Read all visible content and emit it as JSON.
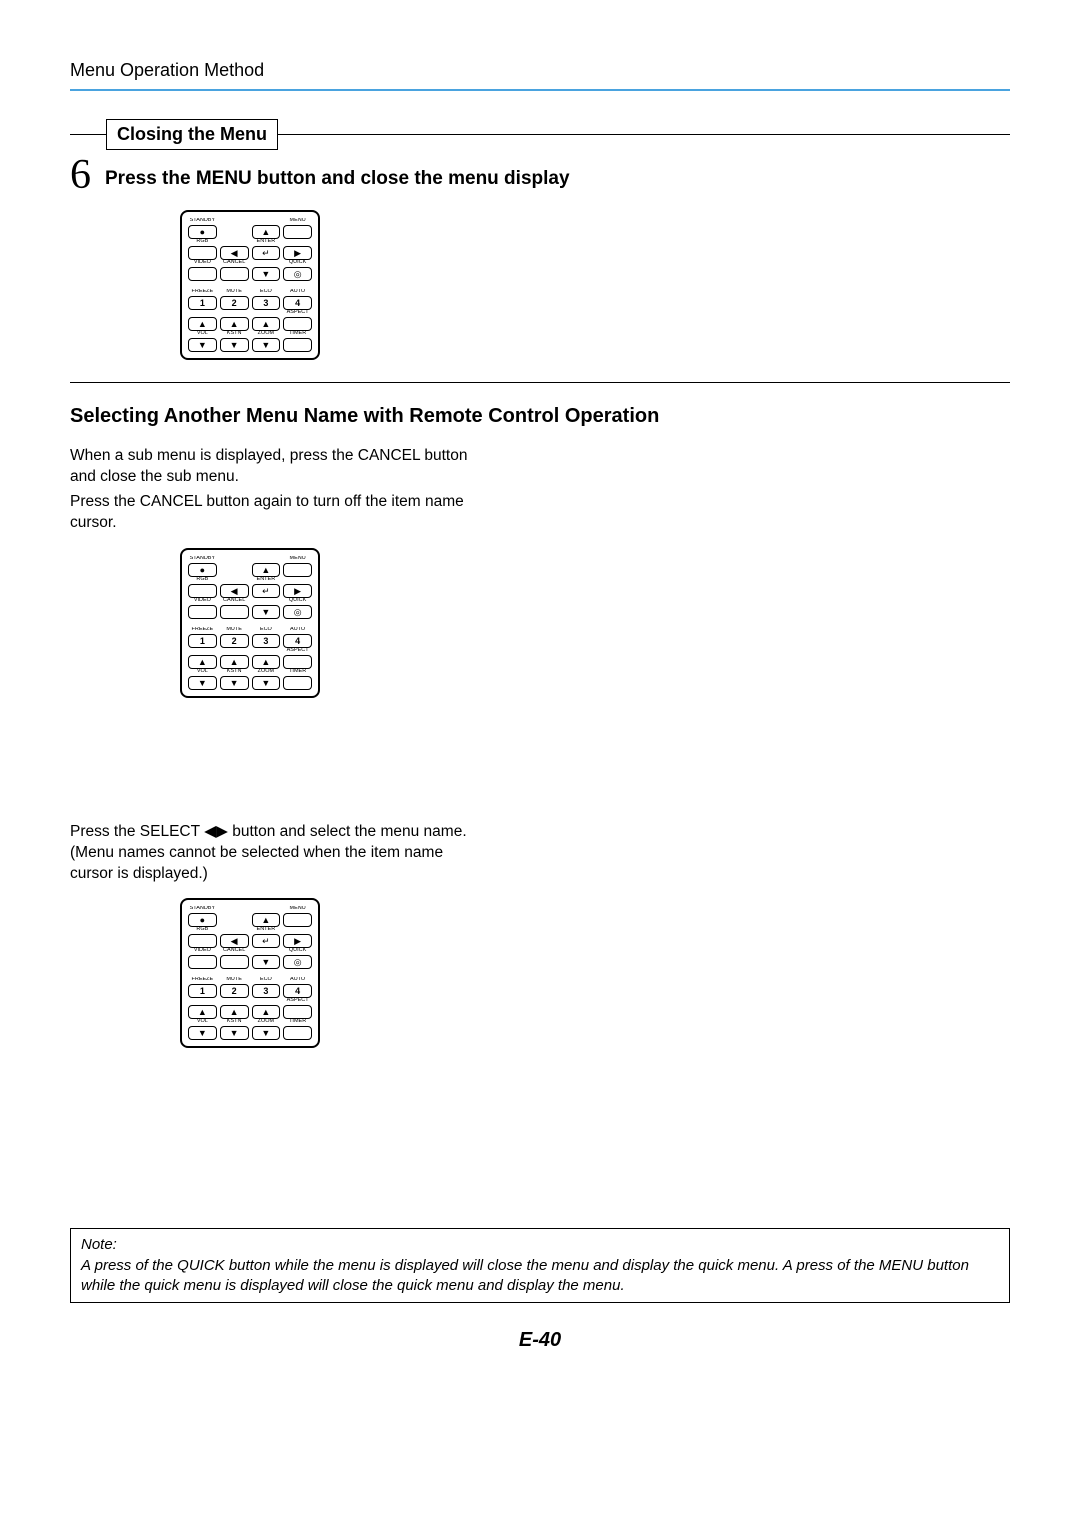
{
  "header": {
    "title": "Menu Operation Method"
  },
  "closing_section": {
    "box_title": "Closing the Menu",
    "step_number": "6",
    "step_text": "Press the MENU button and close the menu display"
  },
  "selecting_section": {
    "title": "Selecting Another Menu Name with Remote Control Operation",
    "para1": "When a sub menu is displayed, press the CANCEL button and close the sub menu.",
    "para2": "Press the CANCEL button again to turn off the item name cursor.",
    "para3a": "Press the SELECT ",
    "para3_arrows": "◀▶",
    "para3b": " button and select the menu name. (Menu names cannot be selected when the item name cursor is displayed.)"
  },
  "remote": {
    "row1_labels": [
      "STANDBY",
      "",
      "",
      "MENU"
    ],
    "row1_icons": [
      "●",
      "",
      "▲",
      ""
    ],
    "row2_labels": [
      "RGB",
      "",
      "ENTER",
      ""
    ],
    "row2_icons": [
      "",
      "◀",
      "↵",
      "▶"
    ],
    "row3_labels": [
      "VIDEO",
      "CANCEL",
      "",
      "QUICK"
    ],
    "row3_icons": [
      "",
      "",
      "▼",
      "◎"
    ],
    "row4_labels": [
      "FREEZE",
      "MUTE",
      "ECO",
      "AUTO"
    ],
    "row4_icons": [
      "1",
      "2",
      "3",
      "4"
    ],
    "row5_labels": [
      "",
      "",
      "",
      "ASPECT"
    ],
    "row5_icons": [
      "▲",
      "▲",
      "▲",
      ""
    ],
    "row6_labels": [
      "VOL",
      "KSTN",
      "ZOOM",
      "TIMER"
    ],
    "row6_icons": [
      "▼",
      "▼",
      "▼",
      ""
    ]
  },
  "note": {
    "label": "Note:",
    "text": "A press of the QUICK button while the menu is displayed will close the menu and display the quick menu. A press of the MENU button while the quick menu is displayed will close the quick menu and display the menu."
  },
  "page_number": "E-40"
}
